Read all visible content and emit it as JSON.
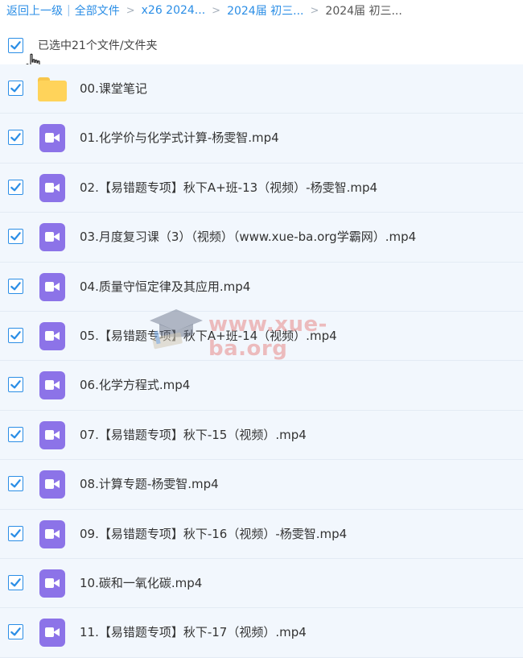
{
  "breadcrumb": {
    "back": "返回上一级",
    "all_files": "全部文件",
    "crumb1": "x26 2024...",
    "crumb2": "2024届 初三...",
    "current": "2024届 初三..."
  },
  "selection": {
    "label": "已选中21个文件/文件夹",
    "checked": true
  },
  "files": [
    {
      "name": "00.课堂笔记",
      "type": "folder"
    },
    {
      "name": "01.化学价与化学式计算-杨雯智.mp4",
      "type": "video"
    },
    {
      "name": "02.【易错题专项】秋下A+班-13（视频）-杨雯智.mp4",
      "type": "video"
    },
    {
      "name": "03.月度复习课（3）（视频）（www.xue-ba.org学霸网）.mp4",
      "type": "video"
    },
    {
      "name": "04.质量守恒定律及其应用.mp4",
      "type": "video"
    },
    {
      "name": "05.【易错题专项】秋下A+班-14（视频）.mp4",
      "type": "video"
    },
    {
      "name": "06.化学方程式.mp4",
      "type": "video"
    },
    {
      "name": "07.【易错题专项】秋下-15（视频）.mp4",
      "type": "video"
    },
    {
      "name": "08.计算专题-杨雯智.mp4",
      "type": "video"
    },
    {
      "name": "09.【易错题专项】秋下-16（视频）-杨雯智.mp4",
      "type": "video"
    },
    {
      "name": "10.碳和一氧化碳.mp4",
      "type": "video"
    },
    {
      "name": "11.【易错题专项】秋下-17（视频）.mp4",
      "type": "video"
    }
  ],
  "watermark": {
    "text": "www.xue-ba.org"
  },
  "colors": {
    "accent": "#2b8ee6",
    "row_bg": "#f2f7fd",
    "video_icon": "#8c73e8",
    "folder_icon": "#ffd35a"
  }
}
